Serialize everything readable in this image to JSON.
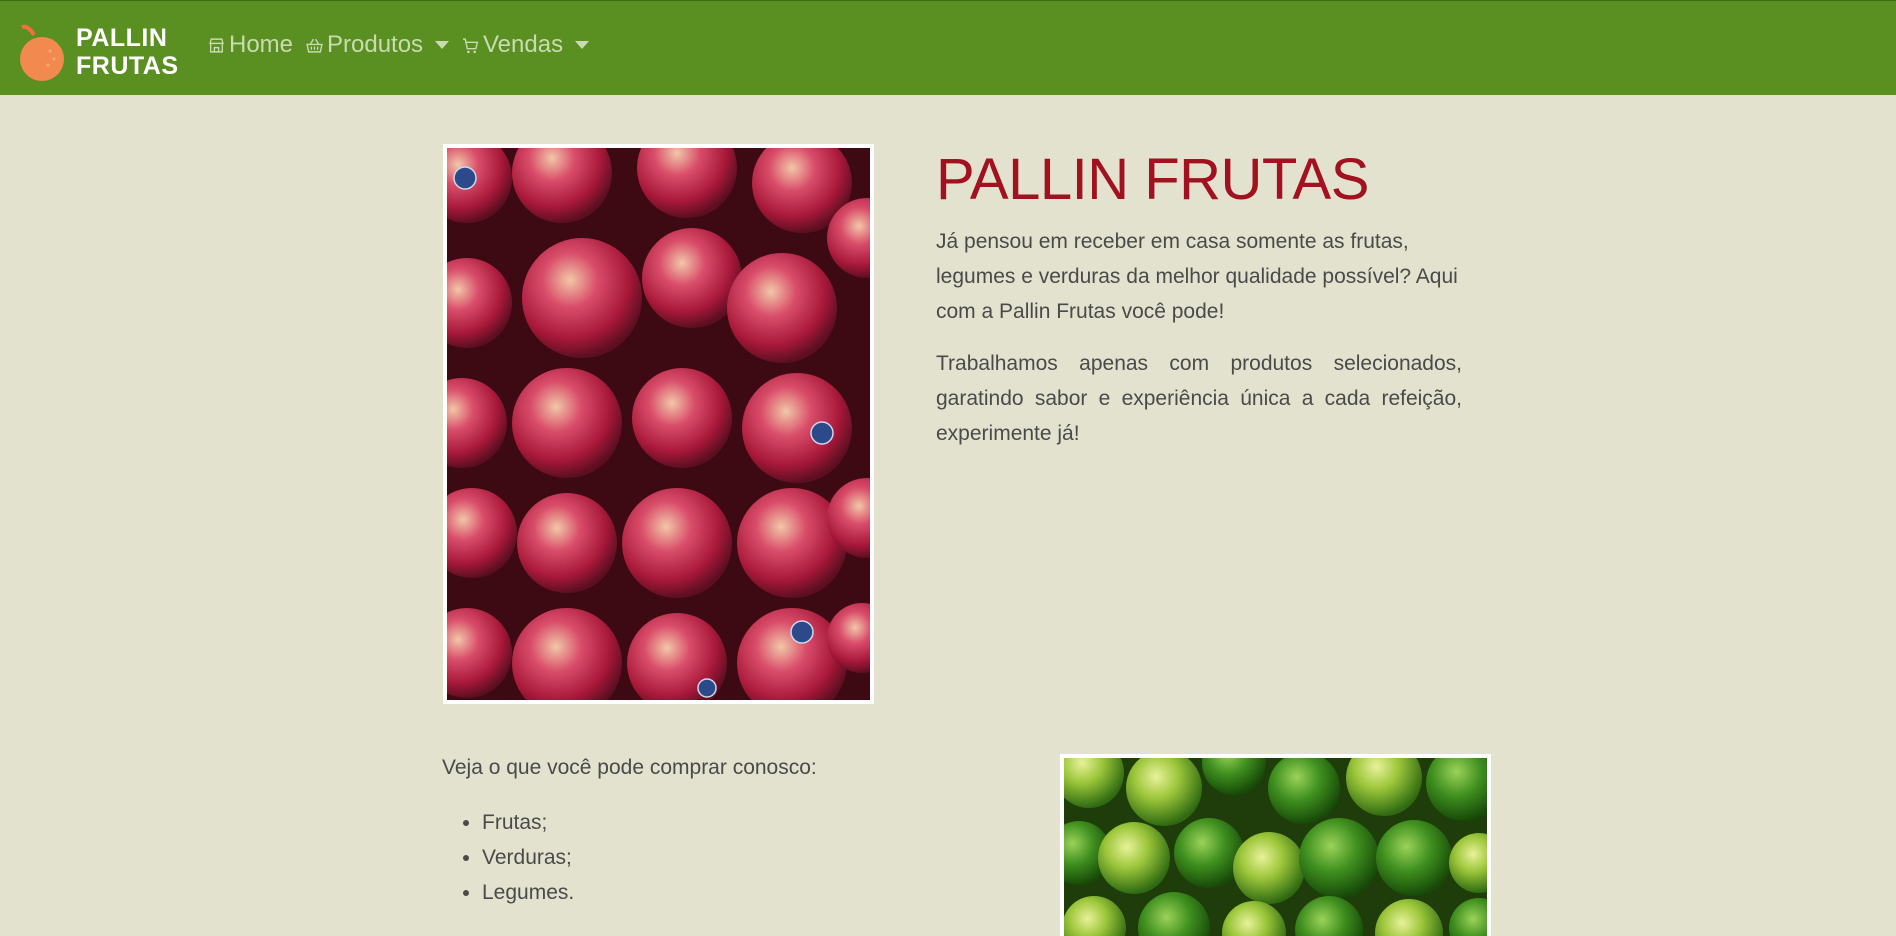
{
  "navbar": {
    "brand": {
      "line1": "PALLIN",
      "line2": "FRUTAS"
    },
    "items": [
      {
        "label": "Home",
        "icon": "store-icon"
      },
      {
        "label": "Produtos",
        "icon": "basket-icon",
        "dropdown": true
      },
      {
        "label": "Vendas",
        "icon": "cart-icon",
        "dropdown": true
      }
    ],
    "color": "#5a8f22"
  },
  "hero": {
    "title": "PALLIN FRUTAS",
    "paragraph1": "Já pensou em receber em casa somente as frutas, legumes e verduras da melhor qualidade possível? Aqui com a Pallin Frutas você pode!",
    "paragraph2": "Trabalhamos apenas com produtos selecionados, garatindo sabor e experiência única a cada refeição, experimente já!",
    "title_color": "#a1111f"
  },
  "products": {
    "intro": "Veja o que você pode comprar conosco:",
    "items": [
      "Frutas;",
      "Verduras;",
      "Legumes."
    ]
  },
  "images": {
    "apples": "apples-photo",
    "limes": "limes-photo"
  }
}
